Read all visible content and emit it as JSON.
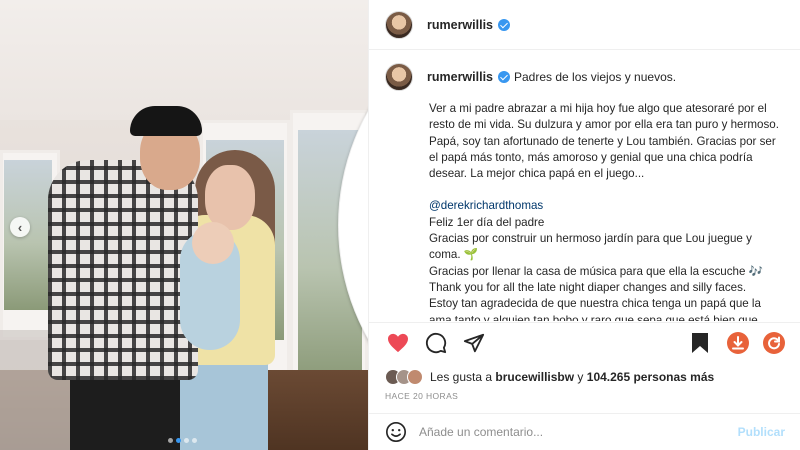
{
  "post": {
    "author": "rumerwillis",
    "verified_icon": "verified-badge-icon",
    "carousel": {
      "slide_count": 4,
      "active_index": 0
    }
  },
  "caption": {
    "first_line": "Padres de los viejos y nuevos.",
    "paragraph1": "Ver a mi padre abrazar a mi hija hoy fue algo que atesoraré por el resto de mi vida. Su dulzura y amor por ella era tan puro y hermoso. Papá, soy tan afortunado de tenerte y Lou también. Gracias por ser el papá más tonto, más amoroso y genial que una chica podría desear. La mejor chica papá en el juego...",
    "mention": "@derekrichardthomas",
    "line1": "Feliz 1er día del padre",
    "line2": "Gracias por construir un hermoso jardín para que Lou juegue y coma. 🌱",
    "line3": "Gracias por llenar la casa de música para que ella la escuche 🎶",
    "line4": "Thank you for all the late night diaper changes and silly faces.",
    "line5": "Estoy tan agradecida de que nuestra chica tenga un papá que la ama tanto y alguien tan bobo y raro que sepa que está bien que"
  },
  "likes": {
    "prefix": "Les gusta a",
    "user": "brucewillisbw",
    "joiner": "y",
    "others": "104.265 personas más"
  },
  "timestamp": "HACE 20 HORAS",
  "comment": {
    "placeholder": "Añade un comentario...",
    "publish_label": "Publicar"
  },
  "colors": {
    "like": "#ed4956",
    "accent": "#3897f0",
    "publish_disabled": "#b2dffc",
    "download_orange": "#e8623a"
  }
}
